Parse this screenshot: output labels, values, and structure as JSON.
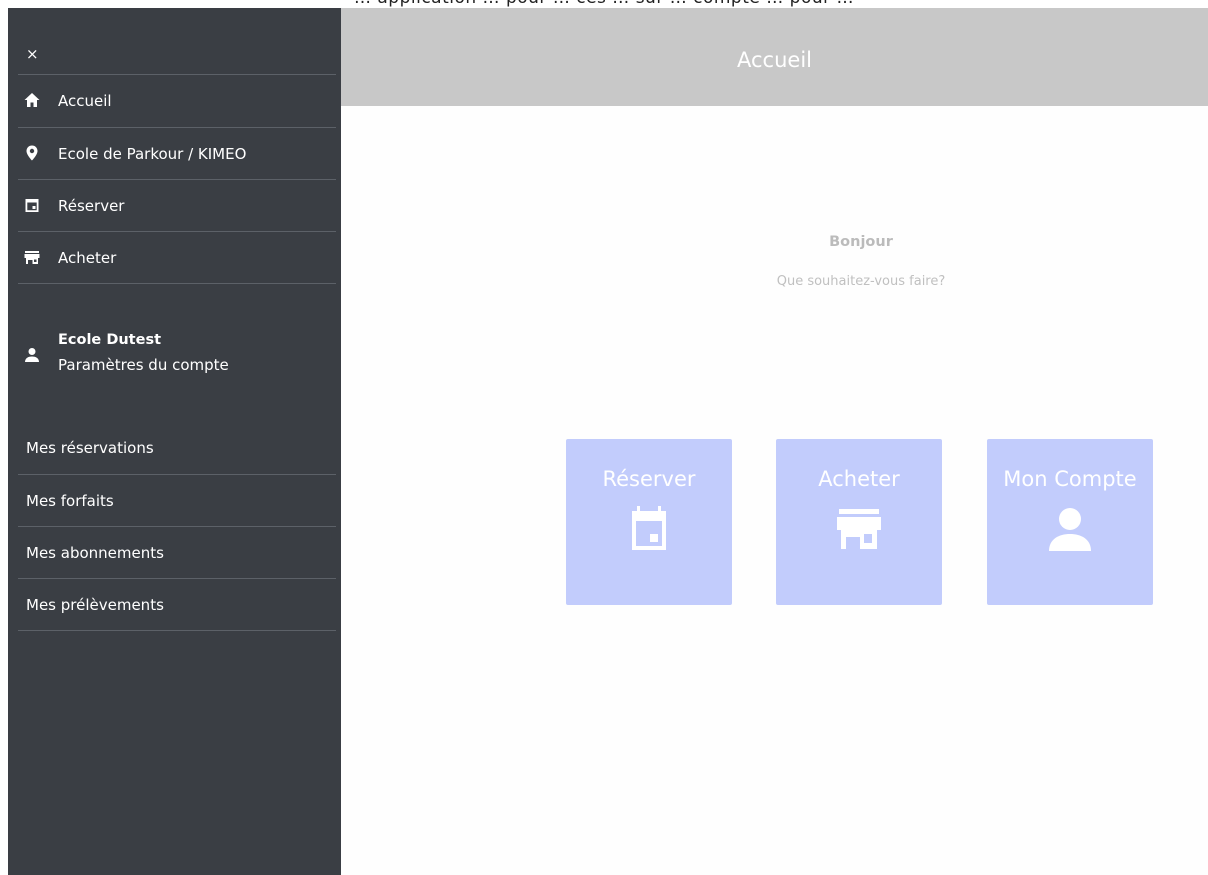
{
  "top_strip": {
    "text": "… application … pour … ces … sur … compte … pour …"
  },
  "sidebar": {
    "close_icon": "×",
    "nav_items": [
      {
        "label": "Accueil",
        "icon": "home-icon"
      },
      {
        "label": "Ecole de Parkour / KIMEO",
        "icon": "location-pin-icon"
      },
      {
        "label": "Réserver",
        "icon": "calendar-icon"
      },
      {
        "label": "Acheter",
        "icon": "store-icon"
      }
    ],
    "account": {
      "name": "Ecole Dutest",
      "settings_label": "Paramètres du compte",
      "icon": "person-icon"
    },
    "secondary_items": [
      {
        "label": "Mes réservations"
      },
      {
        "label": "Mes forfaits"
      },
      {
        "label": "Mes abonnements"
      },
      {
        "label": "Mes prélèvements"
      }
    ]
  },
  "header": {
    "title": "Accueil"
  },
  "main": {
    "greeting": "Bonjour",
    "question": "Que souhaitez-vous faire?",
    "tiles": [
      {
        "label": "Réserver",
        "icon": "calendar-icon"
      },
      {
        "label": "Acheter",
        "icon": "store-icon"
      },
      {
        "label": "Mon Compte",
        "icon": "person-icon"
      }
    ]
  },
  "colors": {
    "sidebar_bg": "#3a3e44",
    "header_bg": "#c8c8c8",
    "tile_bg": "#c2ccfc"
  }
}
